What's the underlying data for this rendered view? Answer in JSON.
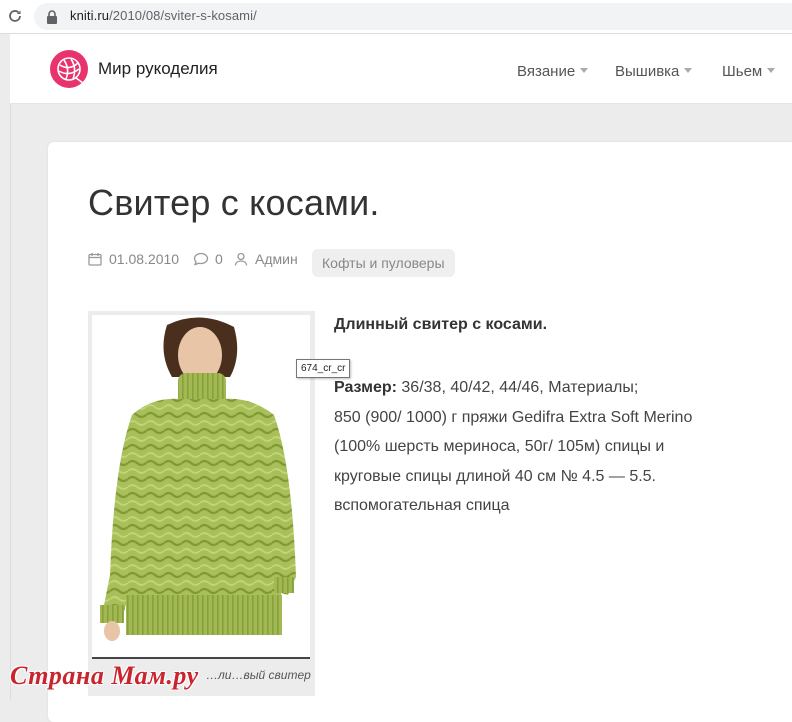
{
  "browser": {
    "url_host": "kniti.ru",
    "url_path": "/2010/08/sviter-s-kosami/"
  },
  "header": {
    "site_title": "Мир рукоделия",
    "logo_icon": "yarn-ball-icon",
    "brand_color": "#e8336d",
    "nav": [
      {
        "label": "Вязание"
      },
      {
        "label": "Вышивка"
      },
      {
        "label": "Шьем"
      }
    ]
  },
  "post": {
    "title": "Свитер с косами.",
    "date": "01.08.2010",
    "comments": "0",
    "author": "Админ",
    "category": "Кофты и пуловеры",
    "image_tooltip": "674_cr_cr",
    "image_caption": "…ли…вый свитер",
    "lead": "Длинный свитер с косами.",
    "size_label": "Размер:",
    "size_value": " 36/38, 40/42, 44/46, Материалы;",
    "materials_lines": [
      "850 (900/ 1000) г пряжи Gedifra Extra Soft Merino",
      "(100% шерсть мериноса, 50г/ 105м) спицы и",
      "круговые спицы длиной 40 см № 4.5 — 5.5.",
      "вспомогательная спица"
    ]
  },
  "watermark": "Страна Мам.ру"
}
